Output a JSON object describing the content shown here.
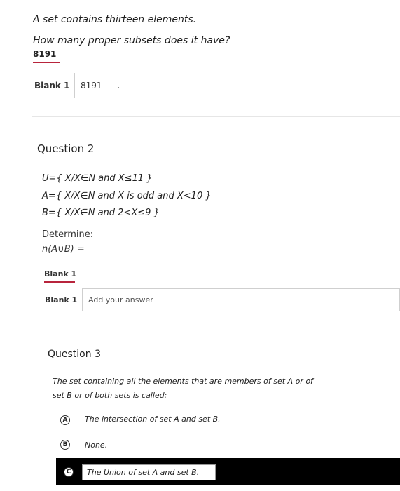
{
  "q1": {
    "line1": "A set contains thirteen elements.",
    "line2": "How many proper subsets does it have?",
    "answer_shown": "8191",
    "blank_label": "Blank 1",
    "blank_value": "8191",
    "blank_dot": "."
  },
  "q2": {
    "title": "Question 2",
    "u_def": "U={ X/X∈N and X≤11 }",
    "a_def": "A={ X/X∈N and X is odd and X<10 }",
    "b_def": "B={ X/X∈N and 2<X≤9 }",
    "determine": "Determine:",
    "expr": "n(A∪B) =",
    "blank_tab": "Blank 1",
    "blank_label": "Blank 1",
    "blank_placeholder": "Add your answer"
  },
  "q3": {
    "title": "Question 3",
    "prompt_line1": "The set containing all the elements that are members of set A or of",
    "prompt_line2": "set B or of both sets is called:",
    "options": [
      {
        "letter": "A",
        "text": "The intersection of set A and set B."
      },
      {
        "letter": "B",
        "text": "None."
      },
      {
        "letter": "C",
        "text": "The Union of set A and set B."
      }
    ],
    "selected": "C"
  }
}
